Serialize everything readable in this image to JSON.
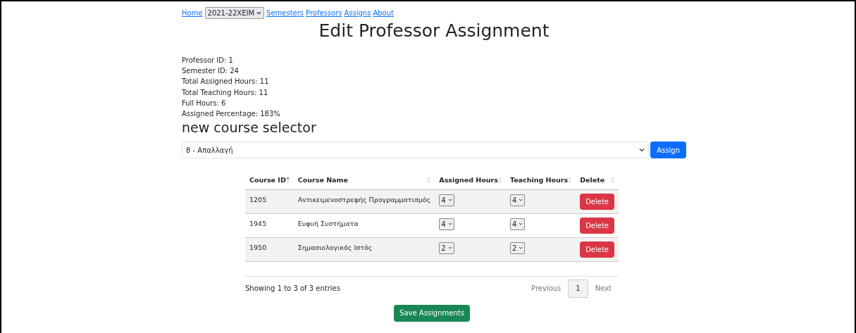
{
  "nav": {
    "links": [
      {
        "label": "Home"
      },
      {
        "label": "Semesters"
      },
      {
        "label": "Professors"
      },
      {
        "label": "Assigns"
      },
      {
        "label": "About"
      }
    ],
    "semester_select": "2021-22XEIM"
  },
  "title": "Edit Professor Assignment",
  "info": [
    "Professor ID: 1",
    "Semester ID: 24",
    "Total Assigned Hours: 11",
    "Total Teaching Hours: 11",
    "Full Hours: 6",
    "Assigned Percentage: 183%"
  ],
  "selector": {
    "heading": "new course selector",
    "value": "8 - Απαλλαγή",
    "button": "Assign"
  },
  "table": {
    "columns": [
      {
        "label": "Course ID",
        "sorted": true
      },
      {
        "label": "Course Name",
        "sorted": false
      },
      {
        "label": "Assigned Hours",
        "sorted": false
      },
      {
        "label": "Teaching Hours",
        "sorted": false
      },
      {
        "label": "Delete",
        "sorted": false
      }
    ],
    "rows": [
      {
        "id": "1205",
        "name": "Αντικειμενοστρεφής Προγραμματισμός",
        "assigned": "4",
        "teaching": "4",
        "action": "Delete"
      },
      {
        "id": "1945",
        "name": "Ευφυή Συστήματα",
        "assigned": "4",
        "teaching": "4",
        "action": "Delete"
      },
      {
        "id": "1950",
        "name": "Σημασιολογικός Ιστός",
        "assigned": "2",
        "teaching": "2",
        "action": "Delete"
      }
    ]
  },
  "footer": {
    "info": "Showing 1 to 3 of 3 entries",
    "pages": [
      {
        "label": "Previous",
        "selected": false
      },
      {
        "label": "1",
        "selected": true
      },
      {
        "label": "Next",
        "selected": false
      }
    ]
  },
  "save_button": "Save Assignments"
}
